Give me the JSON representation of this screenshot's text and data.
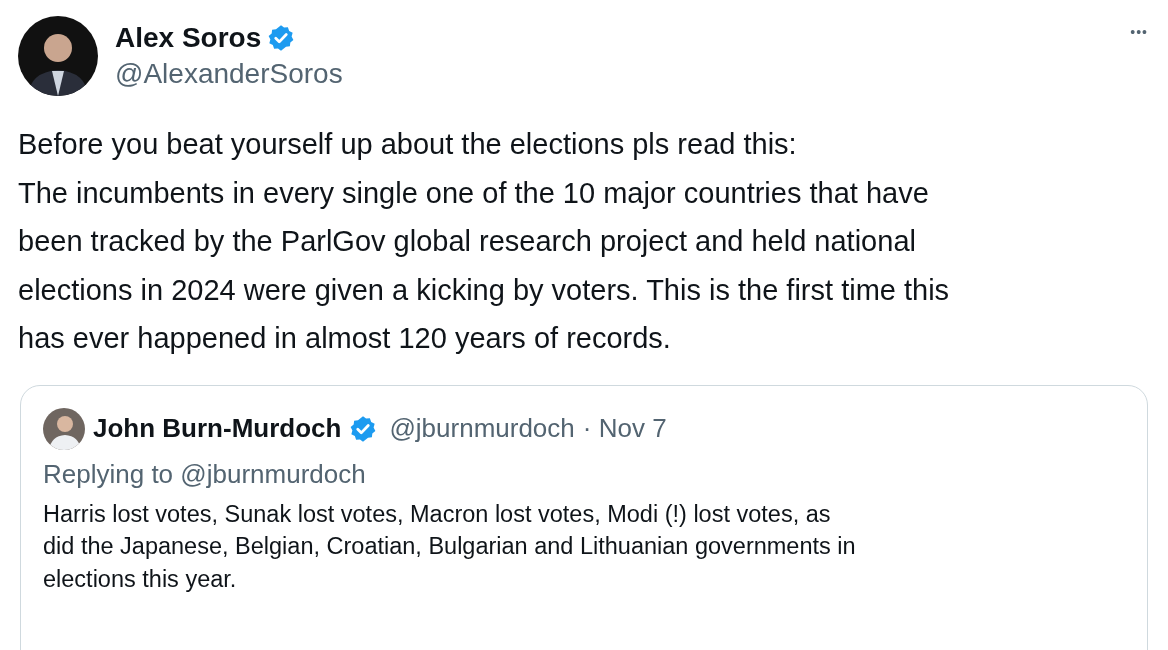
{
  "author": {
    "name": "Alex Soros",
    "verified": true,
    "handle": "@AlexanderSoros"
  },
  "more_button": "•••",
  "text_lines": [
    "Before you beat yourself up about the elections pls read this:",
    "The incumbents in every single one of the 10 major countries that have",
    "been tracked by the ParlGov global research project and held national",
    "elections in 2024 were given a kicking by voters. This is the first time this",
    "has ever happened in almost 120 years of records."
  ],
  "quoted_tweet": {
    "name": "John Burn-Murdoch",
    "verified": true,
    "handle": "@jburnmurdoch",
    "date": "· Nov 7",
    "replying_to": "Replying to @jburnmurdoch",
    "text_lines": [
      "Harris lost votes, Sunak lost votes, Macron lost votes, Modi (!) lost votes, as",
      "did the Japanese, Belgian, Croatian, Bulgarian and Lithuanian governments in",
      "elections this year."
    ]
  }
}
